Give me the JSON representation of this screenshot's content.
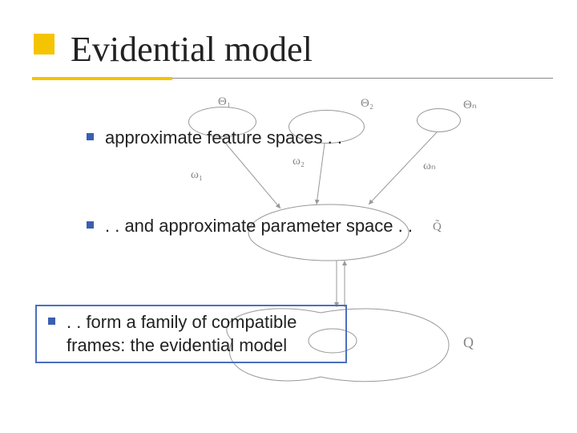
{
  "title": "Evidential model",
  "bullets": {
    "b1": "approximate feature spaces . .",
    "b2": ". . and approximate parameter space . .",
    "b3": ". . form a family of compatible frames: the evidential model"
  },
  "diagram_labels": {
    "theta1": "Θ₁",
    "theta2": "Θ₂",
    "thetan": "Θₙ",
    "omega1": "ω₁",
    "omega2": "ω₂",
    "omegan": "ωₙ",
    "qtilde": "Q̃",
    "q": "Q"
  }
}
